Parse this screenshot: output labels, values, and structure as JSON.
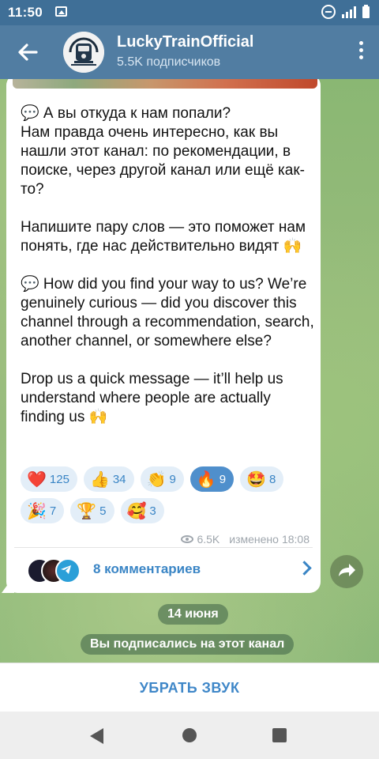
{
  "status_bar": {
    "time": "11:50"
  },
  "header": {
    "channel_name": "LuckyTrainOfficial",
    "subscribers": "5.5K подписчиков"
  },
  "post": {
    "text": "💬 А вы откуда к нам попали?\nНам правда очень интересно, как вы нашли этот канал: по рекомендации, в поиске, через другой канал или ещё как-то?\n\nНапишите пару слов — это поможет нам понять, где нас действительно видят 🙌\n\n💬 How did you find your way to us? We’re genuinely curious — did you discover this channel through a recommendation, search, another channel, or somewhere else?\n\nDrop us a quick message — it’ll help us understand where people are actually finding us 🙌",
    "reactions": [
      {
        "emoji": "❤️",
        "count": "125",
        "active": false
      },
      {
        "emoji": "👍",
        "count": "34",
        "active": false
      },
      {
        "emoji": "👏",
        "count": "9",
        "active": false
      },
      {
        "emoji": "🔥",
        "count": "9",
        "active": true
      },
      {
        "emoji": "🤩",
        "count": "8",
        "active": false
      },
      {
        "emoji": "🎉",
        "count": "7",
        "active": false
      },
      {
        "emoji": "🏆",
        "count": "5",
        "active": false
      },
      {
        "emoji": "🥰",
        "count": "3",
        "active": false
      }
    ],
    "views": "6.5K",
    "edited_label": "изменено",
    "time": "18:08",
    "comments_label": "8 комментариев"
  },
  "service": {
    "date": "14 июня",
    "subscribed": "Вы подписались на этот канал"
  },
  "bottom": {
    "mute_label": "УБРАТЬ ЗВУК"
  },
  "colors": {
    "header": "#517da2",
    "status_bar": "#3f6f97",
    "accent": "#3a85c5",
    "reaction_bg": "#e3eef8",
    "reaction_active": "#4f8fcc"
  }
}
